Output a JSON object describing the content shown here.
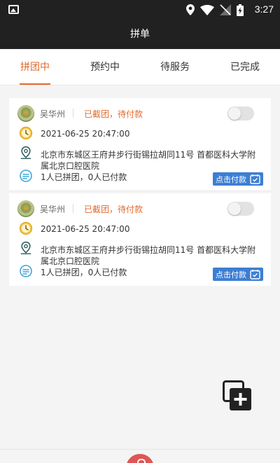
{
  "status_bar": {
    "time": "3:27"
  },
  "app_bar": {
    "title": "拼单"
  },
  "tabs": [
    {
      "label": "拼团中",
      "active": true
    },
    {
      "label": "预约中",
      "active": false
    },
    {
      "label": "待服务",
      "active": false
    },
    {
      "label": "已完成",
      "active": false
    }
  ],
  "orders": [
    {
      "user_name": "吴华州",
      "status": "已截团，待付款",
      "datetime": "2021-06-25 20:47:00",
      "address": "北京市东城区王府井步行街锡拉胡同11号 首都医科大学附属北京口腔医院",
      "group_info": "1人已拼团，0人已付款",
      "pay_label": "点击付款"
    },
    {
      "user_name": "吴华州",
      "status": "已截团，待付款",
      "datetime": "2021-06-25 20:47:00",
      "address": "北京市东城区王府井步行街锡拉胡同11号 首都医科大学附属北京口腔医院",
      "group_info": "1人已拼团，0人已付款",
      "pay_label": "点击付款"
    }
  ],
  "colors": {
    "accent": "#e26a2c",
    "pay_button": "#3d7ed3",
    "header": "#212121"
  }
}
